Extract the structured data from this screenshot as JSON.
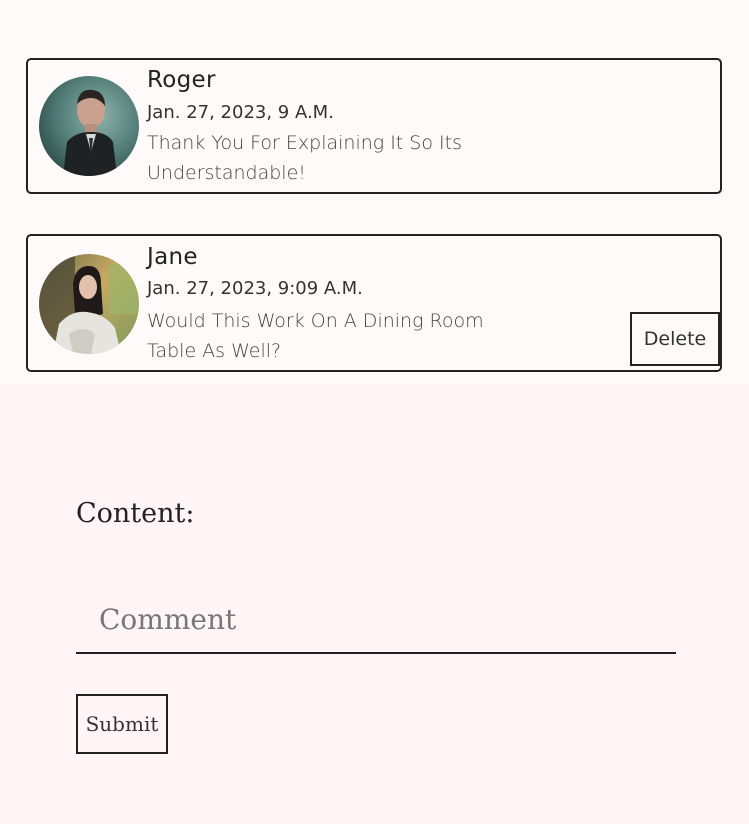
{
  "comments": [
    {
      "author": "Roger",
      "timestamp": "Jan. 27, 2023, 9 A.M.",
      "text": "Thank You For Explaining It So Its Understandable!",
      "avatar_icon": "user-avatar-photo"
    },
    {
      "author": "Jane",
      "timestamp": "Jan. 27, 2023, 9:09 A.M.",
      "text": "Would This Work On A Dining Room Table As Well?",
      "avatar_icon": "user-avatar-photo",
      "delete_label": "Delete"
    }
  ],
  "form": {
    "content_label": "Content:",
    "comment_placeholder": "Comment",
    "comment_value": "",
    "submit_label": "Submit"
  },
  "colors": {
    "page_background": "#fffafa",
    "form_background": "#fff5f7",
    "border": "#222222",
    "text": "#222222"
  }
}
